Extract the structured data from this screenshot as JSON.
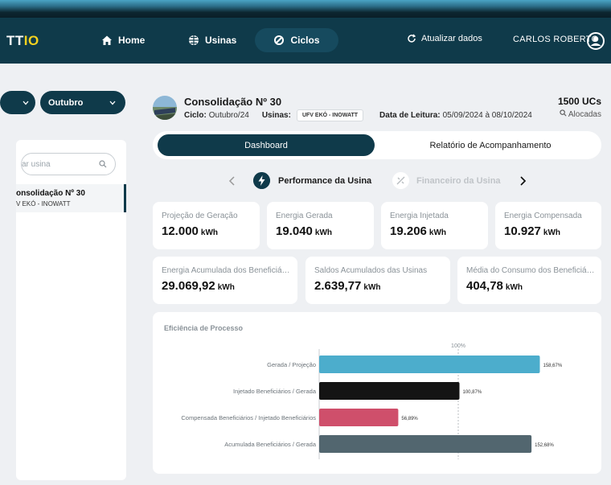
{
  "app": {
    "logo_main": "TT",
    "logo_accent": "IO"
  },
  "nav": {
    "home": "Home",
    "usinas": "Usinas",
    "ciclos": "Ciclos",
    "refresh": "Atualizar dados",
    "user": "CARLOS ROBERTO"
  },
  "sidebar": {
    "month": "Outubro",
    "search_placeholder": "ar usina",
    "item_title": "onsolidação Nº 30",
    "item_sub": "V EKÓ - INOWATT"
  },
  "header": {
    "title": "Consolidação Nº 30",
    "ciclo_label": "Ciclo:",
    "ciclo_value": "Outubro/24",
    "usinas_label": "Usinas:",
    "usinas_chip": "UFV EKÓ - INOWATT",
    "leitura_label": "Data de Leitura:",
    "leitura_value": "05/09/2024 à 08/10/2024",
    "ucs": "1500 UCs",
    "alocadas": "Alocadas"
  },
  "tabs": {
    "dashboard": "Dashboard",
    "relatorio": "Relatório de Acompanhamento"
  },
  "subnav": {
    "performance": "Performance da Usina",
    "financeiro": "Financeiro da Usina"
  },
  "cards_row1": [
    {
      "label": "Projeção de Geração",
      "value": "12.000",
      "unit": "kWh"
    },
    {
      "label": "Energia Gerada",
      "value": "19.040",
      "unit": "kWh"
    },
    {
      "label": "Energia Injetada",
      "value": "19.206",
      "unit": "kWh"
    },
    {
      "label": "Energia Compensada",
      "value": "10.927",
      "unit": "kWh"
    }
  ],
  "cards_row2": [
    {
      "label": "Energia Acumulada dos Beneficiári...",
      "value": "29.069,92",
      "unit": "kWh"
    },
    {
      "label": "Saldos Acumulados das Usinas",
      "value": "2.639,77",
      "unit": "kWh"
    },
    {
      "label": "Média do Consumo dos Beneficiári...",
      "value": "404,78",
      "unit": "kWh"
    }
  ],
  "chart_title": "Eficiência de Processo",
  "chart_data": {
    "type": "bar",
    "orientation": "horizontal",
    "reference_line_label": "100%",
    "reference_value": 100,
    "xlim": [
      0,
      175
    ],
    "categories": [
      "Gerada / Projeção",
      "Injetado Beneficiários / Gerada",
      "Compensada Beneficiários / Injetado Beneficiários",
      "Acumulada Beneficiários / Gerada"
    ],
    "values": [
      158.67,
      100.87,
      56.89,
      152.68
    ],
    "value_labels": [
      "158,67%",
      "100,87%",
      "56,89%",
      "152,68%"
    ],
    "colors": [
      "#4cadcc",
      "#141414",
      "#cf4f6b",
      "#52666f"
    ]
  },
  "colors": {
    "primary": "#0f3a4a",
    "accent": "#f4d21f",
    "bg": "#eef0f3"
  }
}
